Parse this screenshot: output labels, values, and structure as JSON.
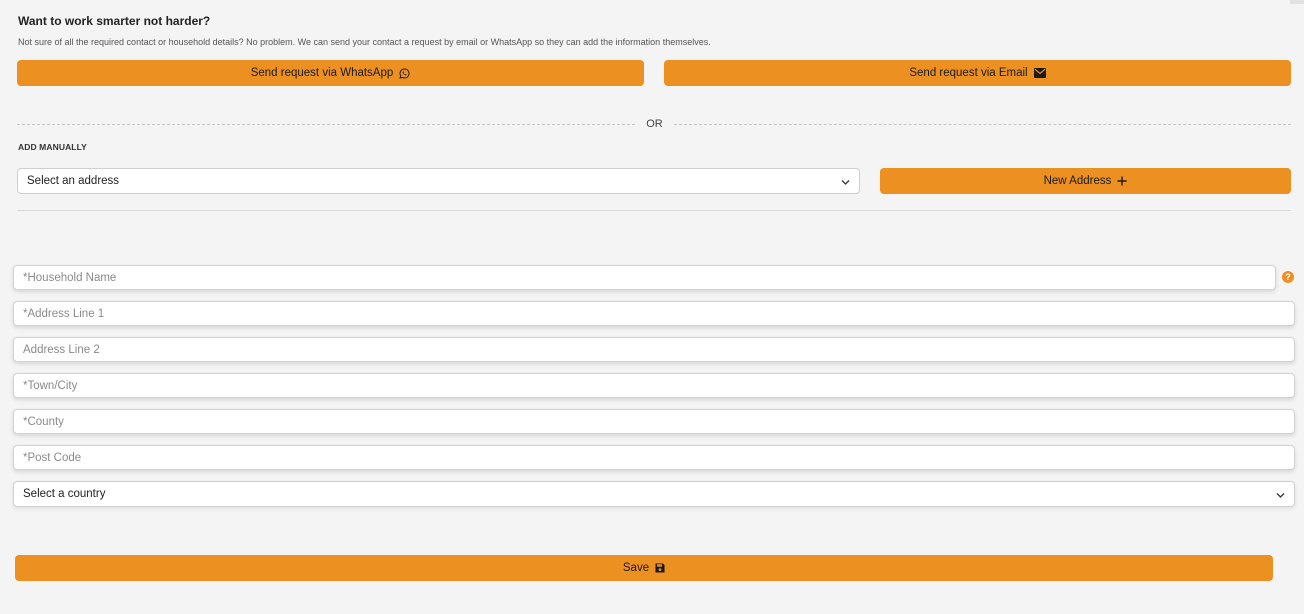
{
  "intro": {
    "title": "Want to work smarter not harder?",
    "description": "Not sure of all the required contact or household details? No problem. We can send your contact a request by email or WhatsApp so they can add the information themselves."
  },
  "requests": {
    "whatsapp_label": "Send request via WhatsApp",
    "whatsapp_icon": "whatsapp-icon",
    "email_label": "Send request via Email",
    "email_icon": "envelope-icon"
  },
  "separator": {
    "or_text": "OR"
  },
  "manual": {
    "heading": "ADD MANUALLY",
    "address_select_value": "Select an address",
    "new_address_label": "New Address",
    "new_address_icon": "plus-icon"
  },
  "form": {
    "household_name_placeholder": "*Household Name",
    "address_line1_placeholder": "*Address Line 1",
    "address_line2_placeholder": "Address Line 2",
    "town_placeholder": "*Town/City",
    "county_placeholder": "*County",
    "postcode_placeholder": "*Post Code",
    "country_select_value": "Select a country",
    "help_icon_text": "?",
    "save_label": "Save",
    "save_icon": "floppy-disk-icon"
  },
  "colors": {
    "accent": "#ec9022",
    "background": "#f4f4f4"
  }
}
